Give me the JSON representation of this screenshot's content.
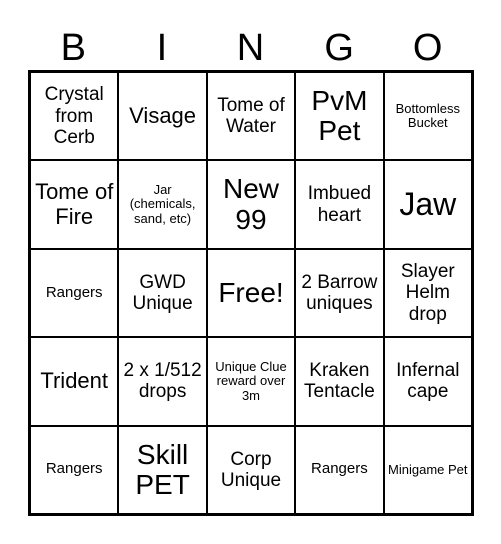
{
  "header": {
    "letters": [
      "B",
      "I",
      "N",
      "G",
      "O"
    ]
  },
  "board": {
    "rows": [
      [
        {
          "text": "Crystal from Cerb",
          "size": "md"
        },
        {
          "text": "Visage",
          "size": "lg"
        },
        {
          "text": "Tome of Water",
          "size": "md"
        },
        {
          "text": "PvM Pet",
          "size": "xl"
        },
        {
          "text": "Bottomless Bucket",
          "size": "xs"
        }
      ],
      [
        {
          "text": "Tome of Fire",
          "size": "lg"
        },
        {
          "text": "Jar (chemicals, sand, etc)",
          "size": "xs"
        },
        {
          "text": "New 99",
          "size": "xl"
        },
        {
          "text": "Imbued heart",
          "size": "md"
        },
        {
          "text": "Jaw",
          "size": "xxl"
        }
      ],
      [
        {
          "text": "Rangers",
          "size": "sm"
        },
        {
          "text": "GWD Unique",
          "size": "md"
        },
        {
          "text": "Free!",
          "size": "xl"
        },
        {
          "text": "2 Barrow uniques",
          "size": "md"
        },
        {
          "text": "Slayer Helm drop",
          "size": "md"
        }
      ],
      [
        {
          "text": "Trident",
          "size": "lg"
        },
        {
          "text": "2 x 1/512 drops",
          "size": "md"
        },
        {
          "text": "Unique Clue reward over 3m",
          "size": "xs"
        },
        {
          "text": "Kraken Tentacle",
          "size": "md"
        },
        {
          "text": "Infernal cape",
          "size": "md"
        }
      ],
      [
        {
          "text": "Rangers",
          "size": "sm"
        },
        {
          "text": "Skill PET",
          "size": "xl"
        },
        {
          "text": "Corp Unique",
          "size": "md"
        },
        {
          "text": "Rangers",
          "size": "sm"
        },
        {
          "text": "Minigame Pet",
          "size": "xs"
        }
      ]
    ]
  }
}
